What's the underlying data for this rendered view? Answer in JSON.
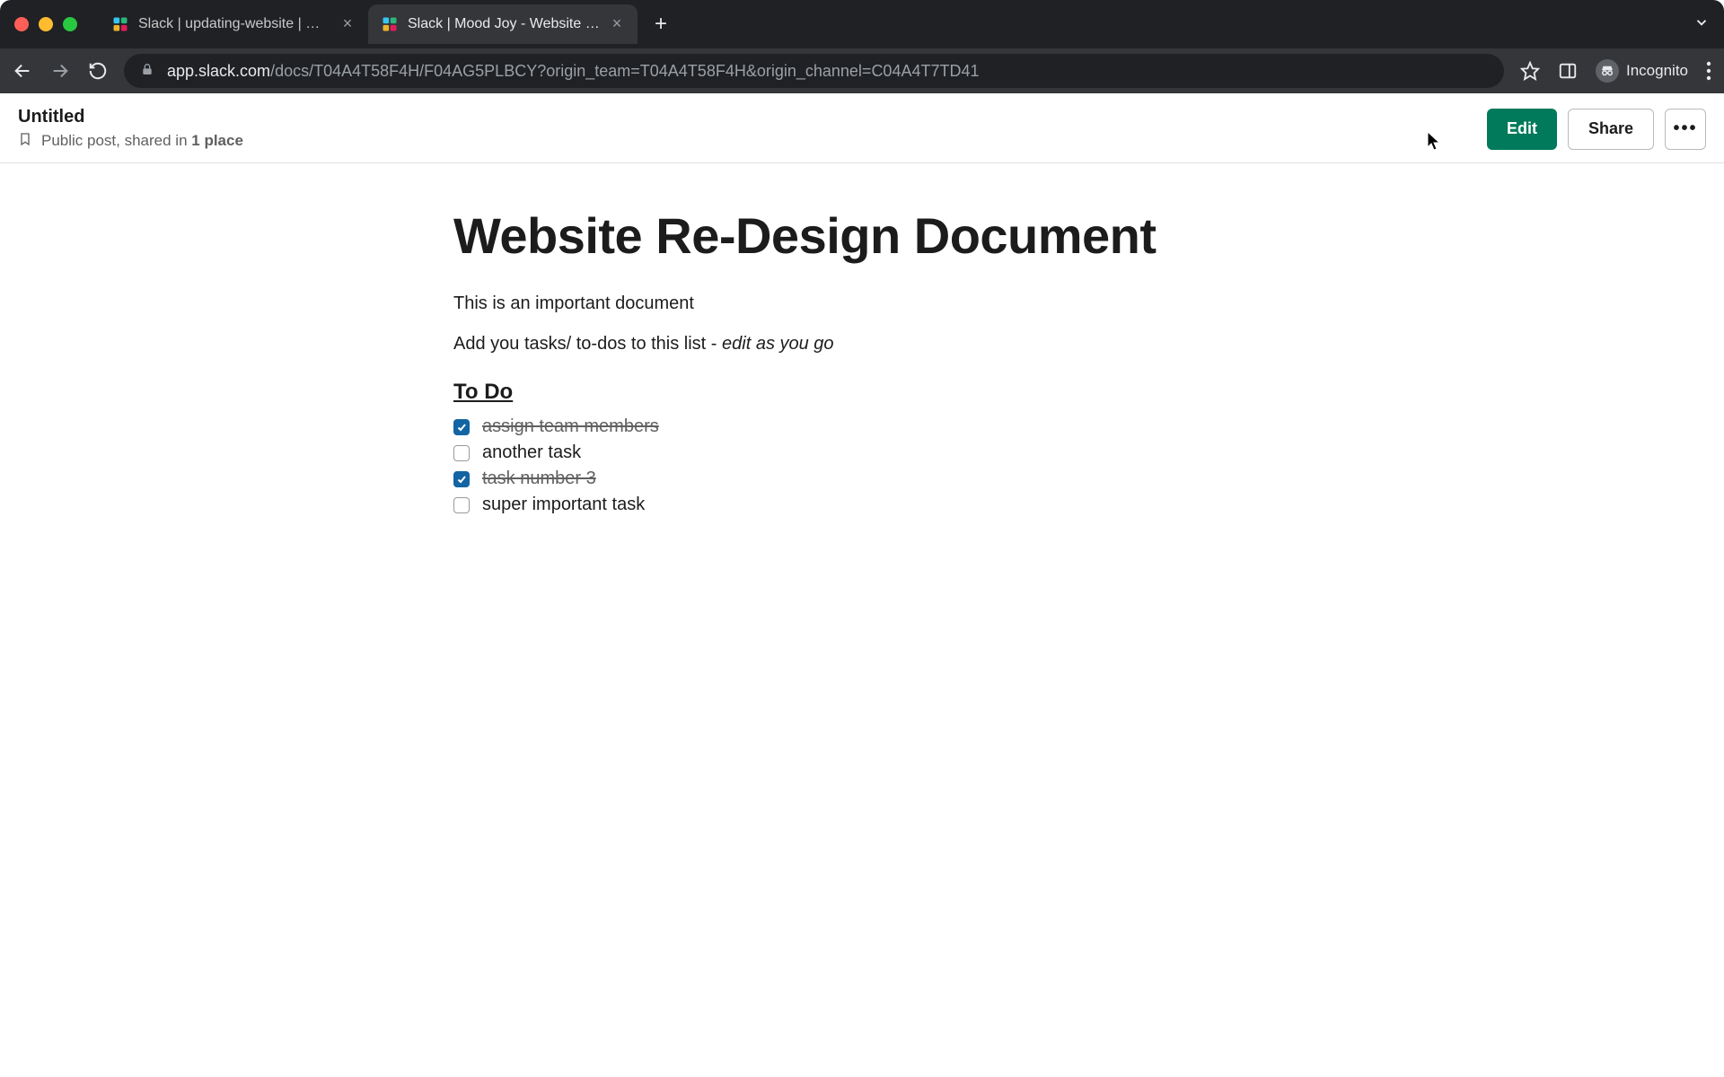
{
  "browser": {
    "tabs": [
      {
        "title": "Slack | updating-website | Moo",
        "active": false
      },
      {
        "title": "Slack | Mood Joy - Website Re",
        "active": true
      }
    ],
    "url_display": {
      "host": "app.slack.com",
      "path": "/docs/T04A4T58F4H/F04AG5PLBCY?origin_team=T04A4T58F4H&origin_channel=C04A4T7TD41"
    },
    "incognito_label": "Incognito"
  },
  "header": {
    "title": "Untitled",
    "subtitle_prefix": "Public post, shared in ",
    "subtitle_count": "1 place",
    "edit_label": "Edit",
    "share_label": "Share",
    "more_label": "•••"
  },
  "document": {
    "title": "Website Re-Design Document",
    "paragraph1": "This is an important document",
    "paragraph2_prefix": "Add you tasks/ to-dos to this list - ",
    "paragraph2_italic": "edit as you go",
    "todo_heading": "To Do ",
    "todos": [
      {
        "text": "assign team members ",
        "checked": true
      },
      {
        "text": "another task",
        "checked": false
      },
      {
        "text": "task number 3 ",
        "checked": true
      },
      {
        "text": "super important task",
        "checked": false
      }
    ]
  }
}
